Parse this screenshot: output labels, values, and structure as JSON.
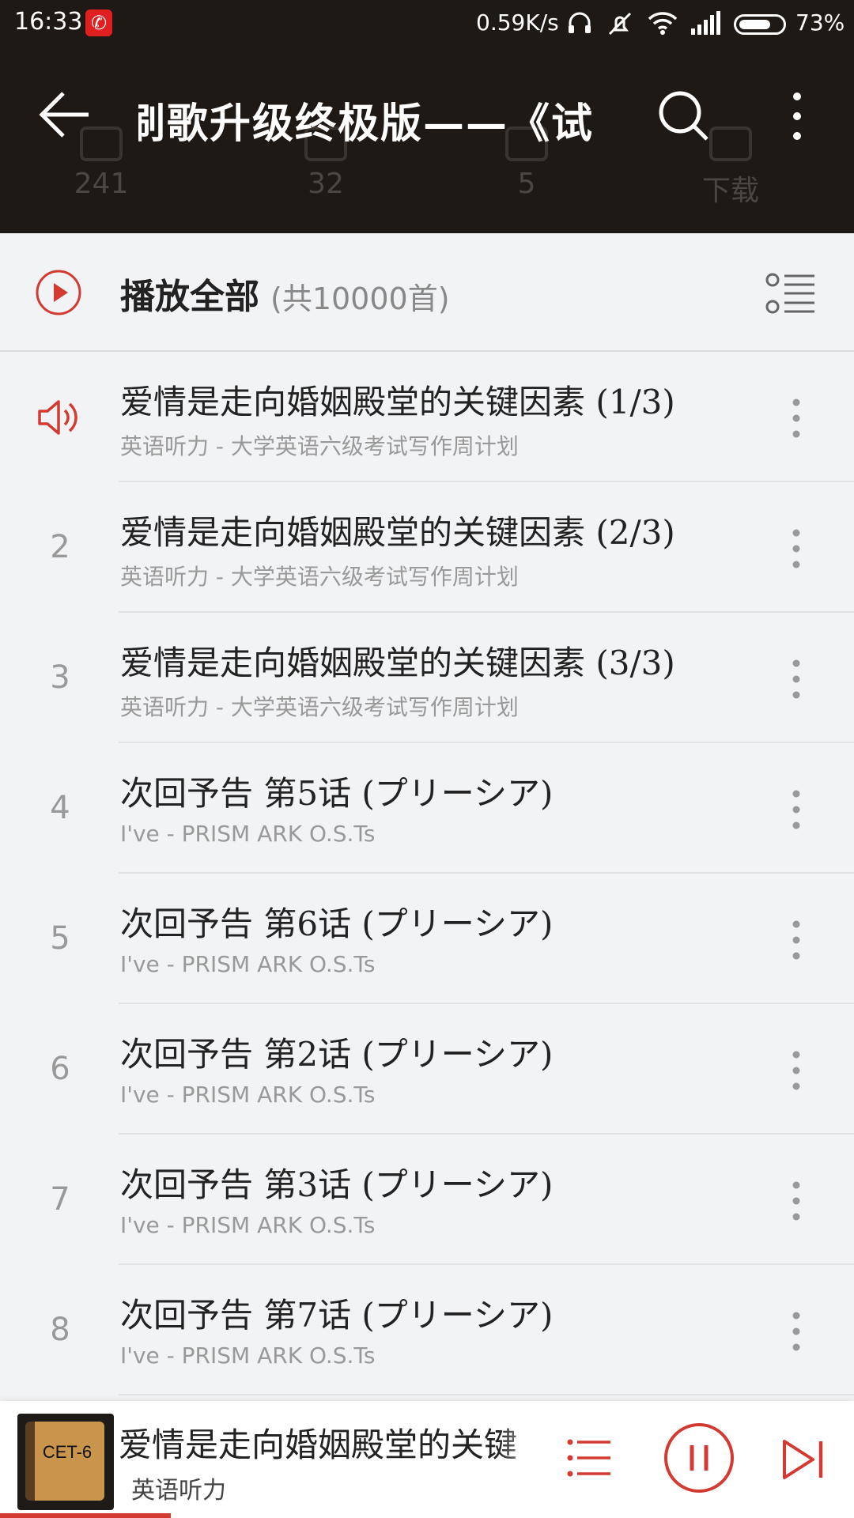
{
  "status_bar": {
    "time": "16:33",
    "app_icon": "netease-music-icon",
    "net_speed": "0.59K/s",
    "battery_pct": "73%",
    "battery_level": 0.73
  },
  "header": {
    "title": "刷歌升级终极版——《试",
    "stats": [
      "241",
      "32",
      "5",
      "下载"
    ]
  },
  "play_all": {
    "label": "播放全部",
    "count": "(共10000首)"
  },
  "tracks": [
    {
      "index": "",
      "playing": true,
      "title": "爱情是走向婚姻殿堂的关键因素 (1/3)",
      "subtitle": "英语听力 - 大学英语六级考试写作周计划"
    },
    {
      "index": "2",
      "playing": false,
      "title": "爱情是走向婚姻殿堂的关键因素 (2/3)",
      "subtitle": "英语听力 - 大学英语六级考试写作周计划"
    },
    {
      "index": "3",
      "playing": false,
      "title": "爱情是走向婚姻殿堂的关键因素 (3/3)",
      "subtitle": "英语听力 - 大学英语六级考试写作周计划"
    },
    {
      "index": "4",
      "playing": false,
      "title": "次回予告 第5话 (プリーシア)",
      "subtitle": "I've - PRISM ARK O.S.Ts"
    },
    {
      "index": "5",
      "playing": false,
      "title": "次回予告 第6话 (プリーシア)",
      "subtitle": "I've - PRISM ARK O.S.Ts"
    },
    {
      "index": "6",
      "playing": false,
      "title": "次回予告 第2话 (プリーシア)",
      "subtitle": "I've - PRISM ARK O.S.Ts"
    },
    {
      "index": "7",
      "playing": false,
      "title": "次回予告 第3话 (プリーシア)",
      "subtitle": "I've - PRISM ARK O.S.Ts"
    },
    {
      "index": "8",
      "playing": false,
      "title": "次回予告 第7话 (プリーシア)",
      "subtitle": "I've - PRISM ARK O.S.Ts"
    }
  ],
  "now_playing": {
    "cover_text": "CET-6",
    "title": "爱情是走向婚姻殿堂的关键",
    "artist": "英语听力",
    "progress": 0.2
  },
  "colors": {
    "accent": "#d33a31",
    "header_bg": "#1f1915",
    "page_bg": "#f2f3f5"
  }
}
